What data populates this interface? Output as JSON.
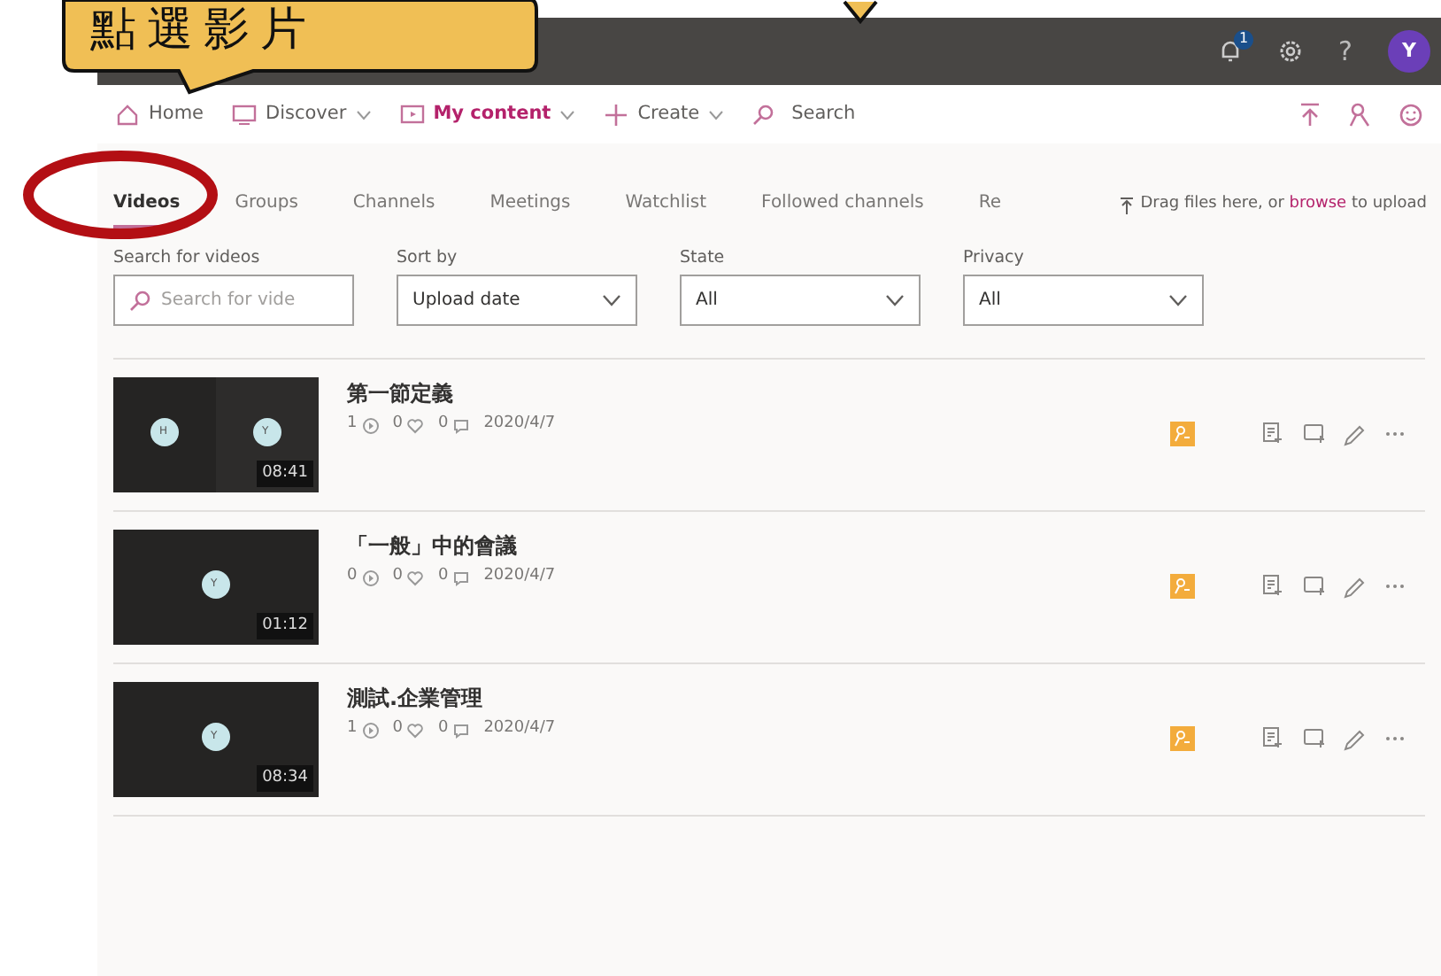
{
  "callouts": [
    {
      "text": "點選影片"
    }
  ],
  "header": {
    "notification_count": "1",
    "help": "?",
    "avatar": "Y"
  },
  "nav": {
    "items": [
      {
        "label": "Home",
        "selected": false,
        "dropdown": false
      },
      {
        "label": "Discover",
        "selected": false,
        "dropdown": true
      },
      {
        "label": "My content",
        "selected": true,
        "dropdown": true
      },
      {
        "label": "Create",
        "selected": false,
        "dropdown": true
      }
    ],
    "search": {
      "placeholder": "Search"
    }
  },
  "tabs": [
    {
      "label": "Videos",
      "selected": true
    },
    {
      "label": "Groups",
      "selected": false
    },
    {
      "label": "Channels",
      "selected": false
    },
    {
      "label": "Meetings",
      "selected": false
    },
    {
      "label": "Watchlist",
      "selected": false
    },
    {
      "label": "Followed channels",
      "selected": false
    },
    {
      "label": "Re",
      "selected": false
    }
  ],
  "upload": {
    "before": "Drag files here, or",
    "link": "browse",
    "after": "to upload"
  },
  "filters": {
    "search": {
      "label": "Search for videos",
      "placeholder": "Search for vide"
    },
    "dropdowns": [
      {
        "label": "Sort by",
        "value": "Upload date"
      },
      {
        "label": "State",
        "value": "All"
      },
      {
        "label": "Privacy",
        "value": "All"
      }
    ]
  },
  "videos": [
    {
      "title": "第一節定義",
      "avatars": [
        "H",
        "Y"
      ],
      "duration": "08:41",
      "views": "1",
      "likes": "0",
      "comments": "0",
      "date": "2020/4/7"
    },
    {
      "title": "「一般」中的會議",
      "avatars": [
        "Y"
      ],
      "duration": "01:12",
      "views": "0",
      "likes": "0",
      "comments": "0",
      "date": "2020/4/7"
    },
    {
      "title": "測試.企業管理",
      "avatars": [
        "Y"
      ],
      "duration": "08:34",
      "views": "1",
      "likes": "0",
      "comments": "0",
      "date": "2020/4/7"
    }
  ]
}
